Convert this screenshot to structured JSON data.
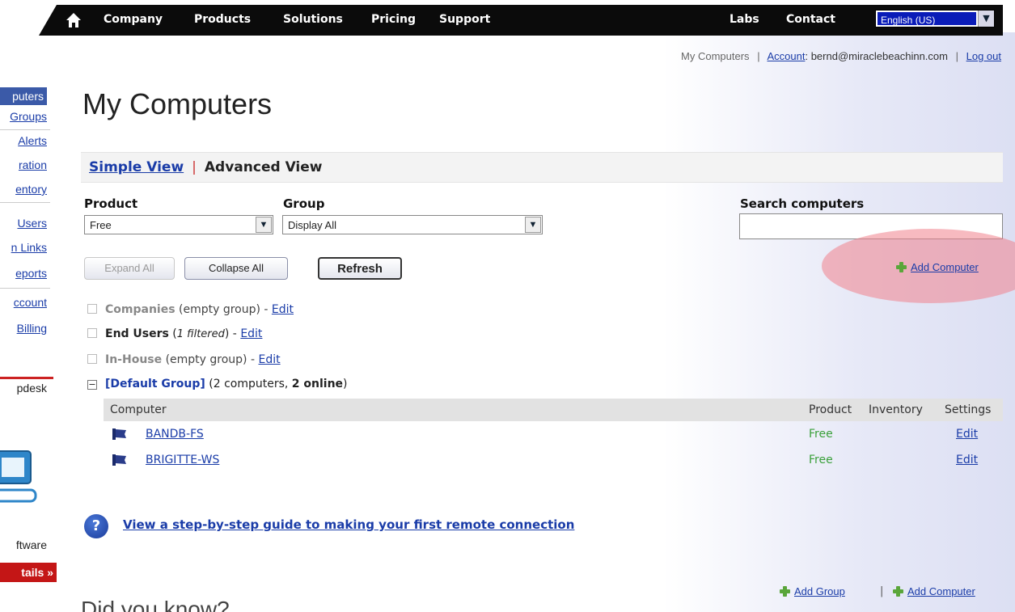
{
  "nav": {
    "items": [
      "Company",
      "Products",
      "Solutions",
      "Pricing",
      "Support"
    ],
    "right_items": [
      "Labs",
      "Contact"
    ],
    "language": "English (US)"
  },
  "account": {
    "my_computers": "My Computers",
    "sep": "|",
    "account_label": "Account",
    "email": ": bernd@miraclebeachinn.com",
    "logout": "Log out"
  },
  "sidebar": {
    "items": [
      "puters",
      "Groups",
      "Alerts",
      "ration",
      "entory",
      "Users",
      "n Links",
      "eports",
      "ccount",
      "Billing"
    ],
    "helpdesk": "pdesk",
    "software": "ftware",
    "details": "tails »"
  },
  "page_title": "My Computers",
  "views": {
    "simple": "Simple View",
    "sep": "|",
    "advanced": "Advanced View"
  },
  "filters": {
    "product_label": "Product",
    "product_value": "Free",
    "group_label": "Group",
    "group_value": "Display All",
    "search_label": "Search computers",
    "search_value": ""
  },
  "buttons": {
    "expand_all": "Expand All",
    "collapse_all": "Collapse All",
    "refresh": "Refresh"
  },
  "add_computer": "Add Computer",
  "add_group": "Add Group",
  "groups": [
    {
      "name": "Companies",
      "note": " (empty group) - ",
      "edit": "Edit"
    },
    {
      "name": "End Users",
      "note_pre": " (",
      "note_italic": "1 filtered",
      "note_post": ") - ",
      "edit": "Edit"
    },
    {
      "name": "In-House",
      "note": " (empty group) - ",
      "edit": "Edit"
    }
  ],
  "default_group": {
    "name": "[Default Group]",
    "count": " (2 computers, ",
    "online": "2 online",
    "close": ")"
  },
  "table": {
    "headers": [
      "Computer",
      "Product",
      "Inventory",
      "Settings"
    ],
    "rows": [
      {
        "computer": "BANDB-FS",
        "product": "Free",
        "settings": "Edit"
      },
      {
        "computer": "BRIGITTE-WS",
        "product": "Free",
        "settings": "Edit"
      }
    ]
  },
  "guide_link": "View a step-by-step guide to making your first remote connection",
  "guide_icon": "?",
  "did_you_know": "Did you know?",
  "colors": {
    "nav_bg": "#0b0b0b",
    "link": "#1a3ca8",
    "free": "#3aa03a",
    "highlight": "#f0828c"
  }
}
